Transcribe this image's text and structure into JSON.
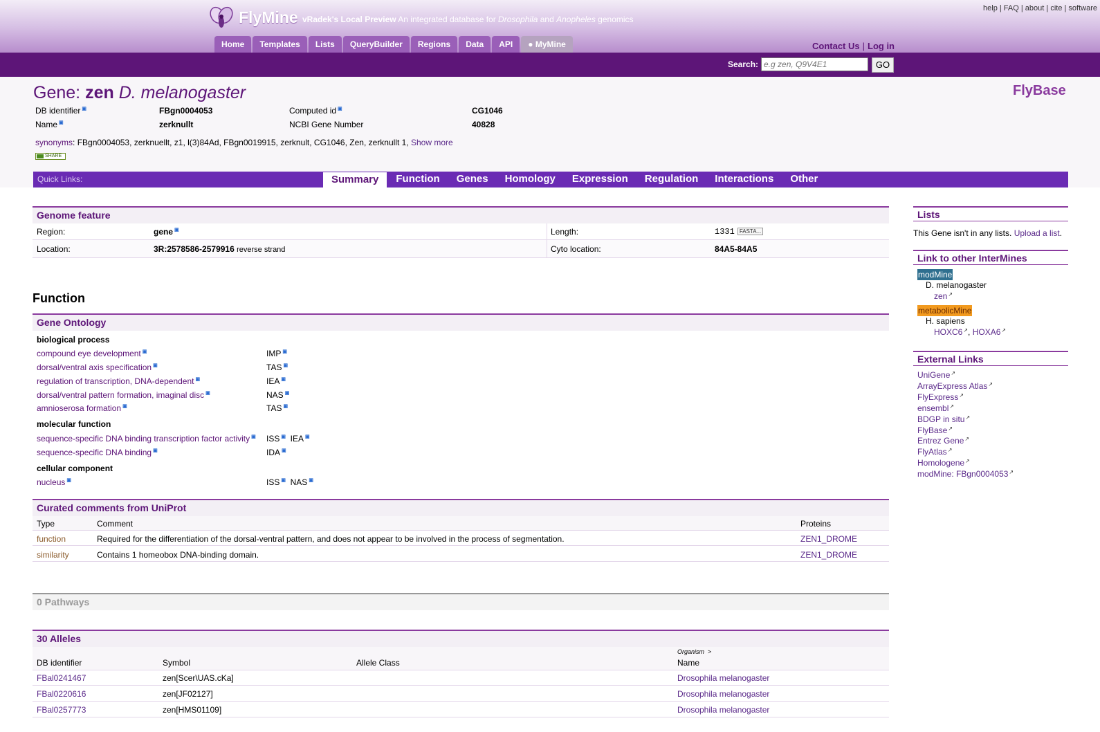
{
  "header": {
    "brand": "FlyMine",
    "preview": "vRadek's Local Preview",
    "tagline_pre": "An integrated database for ",
    "tagline_dro": "Drosophila",
    "tagline_and": " and ",
    "tagline_ano": "Anopheles",
    "tagline_post": " genomics",
    "toplinks": [
      "help",
      "FAQ",
      "about",
      "cite",
      "software"
    ],
    "nav": [
      "Home",
      "Templates",
      "Lists",
      "QueryBuilder",
      "Regions",
      "Data",
      "API",
      "MyMine"
    ],
    "contact": "Contact Us",
    "login": "Log in",
    "search_label": "Search:",
    "search_placeholder": "e.g zen, Q9V4E1",
    "go": "GO"
  },
  "report": {
    "title_prefix": "Gene: ",
    "title_symbol": "zen",
    "title_organism": "D. melanogaster",
    "source": "FlyBase",
    "fields": {
      "db_identifier_label": "DB identifier",
      "db_identifier": "FBgn0004053",
      "name_label": "Name",
      "name": "zerknullt",
      "computed_id_label": "Computed id",
      "computed_id": "CG1046",
      "ncbi_label": "NCBI Gene Number",
      "ncbi": "40828"
    },
    "synonyms_label": "synonyms",
    "synonyms": ": FBgn0004053, zerknuellt, z1, l(3)84Ad, FBgn0019915, zerknult, CG1046, Zen, zerknullt 1, ",
    "show_more": "Show more",
    "share": "SHARE"
  },
  "quicklinks": {
    "label": "Quick Links:",
    "tabs": [
      "Summary",
      "Function",
      "Genes",
      "Homology",
      "Expression",
      "Regulation",
      "Interactions",
      "Other"
    ]
  },
  "genome_feature": {
    "title": "Genome feature",
    "region_label": "Region:",
    "region": "gene",
    "length_label": "Length:",
    "length": "1331",
    "fasta": "FASTA...",
    "location_label": "Location:",
    "location": "3R:2578586-2579916",
    "strand": "reverse strand",
    "cyto_label": "Cyto location:",
    "cyto": "84A5-84A5"
  },
  "function_heading": "Function",
  "gene_ontology": {
    "title": "Gene Ontology",
    "bp_label": "biological process",
    "bp": [
      {
        "term": "compound eye development",
        "codes": [
          "IMP"
        ]
      },
      {
        "term": "dorsal/ventral axis specification",
        "codes": [
          "TAS"
        ]
      },
      {
        "term": "regulation of transcription, DNA-dependent",
        "codes": [
          "IEA"
        ]
      },
      {
        "term": "dorsal/ventral pattern formation, imaginal disc",
        "codes": [
          "NAS"
        ]
      },
      {
        "term": "amnioserosa formation",
        "codes": [
          "TAS"
        ]
      }
    ],
    "mf_label": "molecular function",
    "mf": [
      {
        "term": "sequence-specific DNA binding transcription factor activity",
        "codes": [
          "ISS",
          "IEA"
        ]
      },
      {
        "term": "sequence-specific DNA binding",
        "codes": [
          "IDA"
        ]
      }
    ],
    "cc_label": "cellular component",
    "cc": [
      {
        "term": "nucleus",
        "codes": [
          "ISS",
          "NAS"
        ]
      }
    ]
  },
  "curated": {
    "title": "Curated comments from UniProt",
    "headers": [
      "Type",
      "Comment",
      "Proteins"
    ],
    "rows": [
      {
        "type": "function",
        "comment": "Required for the differentiation of the dorsal-ventral pattern, and does not appear to be involved in the process of segmentation.",
        "protein": "ZEN1_DROME"
      },
      {
        "type": "similarity",
        "comment": "Contains 1 homeobox DNA-binding domain.",
        "protein": "ZEN1_DROME"
      }
    ]
  },
  "pathways": {
    "title": "0 Pathways"
  },
  "alleles": {
    "title": "30 Alleles",
    "org_sup": "Organism",
    "org_arrow": ">",
    "headers": [
      "DB identifier",
      "Symbol",
      "Allele Class",
      "Name"
    ],
    "rows": [
      {
        "id": "FBal0241467",
        "symbol": "zen[Scer\\UAS.cKa]",
        "cls": "",
        "name": "Drosophila melanogaster"
      },
      {
        "id": "FBal0220616",
        "symbol": "zen[JF02127]",
        "cls": "",
        "name": "Drosophila melanogaster"
      },
      {
        "id": "FBal0257773",
        "symbol": "zen[HMS01109]",
        "cls": "",
        "name": "Drosophila melanogaster"
      }
    ]
  },
  "sidebar": {
    "lists_title": "Lists",
    "lists_text": "This Gene isn't in any lists. ",
    "upload": "Upload a list",
    "lists_end": ".",
    "intermines_title": "Link to other InterMines",
    "modmine": "modMine",
    "modmine_org": "D. melanogaster",
    "modmine_gene": "zen",
    "metabolic": "metabolicMine",
    "metabolic_org": "H. sapiens",
    "metabolic_genes": [
      "HOXC6",
      "HOXA6"
    ],
    "external_title": "External Links",
    "external": [
      "UniGene",
      "ArrayExpress Atlas",
      "FlyExpress",
      "ensembl",
      "BDGP in situ",
      "FlyBase",
      "Entrez Gene",
      "FlyAtlas",
      "Homologene",
      "modMine: FBgn0004053"
    ]
  },
  "colors": {
    "brand_purple": "#5d1578",
    "quickbar": "#6a2bb4",
    "modmine_badge": "#2e6f8f",
    "metabolic_badge": "#f29a1f"
  }
}
